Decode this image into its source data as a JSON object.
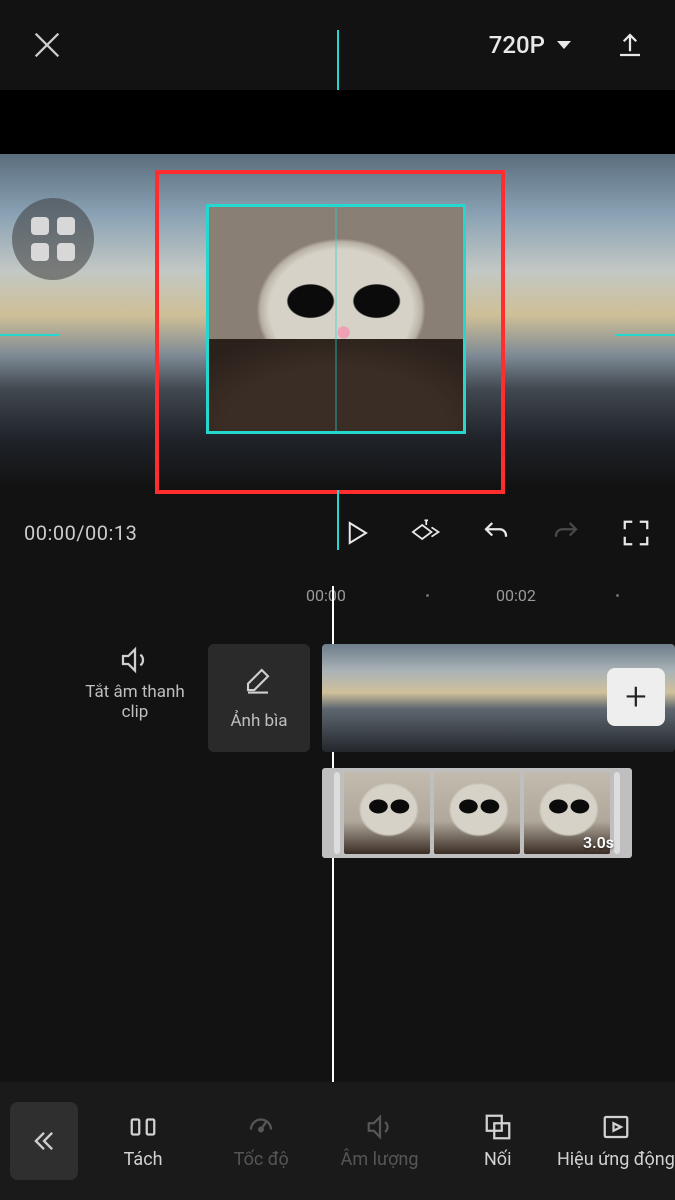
{
  "header": {
    "resolution_label": "720P"
  },
  "player": {
    "time_display": "00:00/00:13"
  },
  "ruler": {
    "mark1": "00:00",
    "mark2": "00:02"
  },
  "timeline": {
    "mute_label": "Tắt âm thanh clip",
    "cover_label": "Ảnh bìa",
    "overlay_duration": "3.0s"
  },
  "tools": {
    "split": "Tách",
    "speed": "Tốc độ",
    "volume": "Âm lượng",
    "join": "Nối",
    "animation": "Hiệu ứng động"
  }
}
